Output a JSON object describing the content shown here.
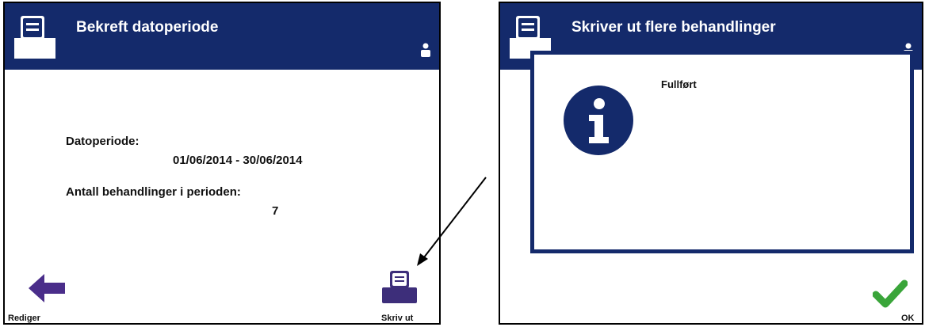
{
  "left_screen": {
    "title": "Bekreft datoperiode",
    "date_period_label": "Datoperiode:",
    "date_period_value": "01/06/2014 - 30/06/2014",
    "treatment_count_label": "Antall behandlinger i perioden:",
    "treatment_count_value": "7",
    "back_label": "Rediger",
    "print_label": "Skriv ut"
  },
  "right_screen": {
    "title": "Skriver ut flere behandlinger",
    "dialog_message": "Fullført",
    "ok_label": "OK"
  },
  "colors": {
    "header": "#142a6b",
    "back_arrow": "#4a2d8a",
    "print_icon": "#3d2e7a",
    "ok_check": "#3aa53a"
  },
  "icons": {
    "header_icon": "printer-icon",
    "user_icon": "user-icon",
    "info_icon": "info-icon",
    "back_icon": "back-arrow-icon",
    "print_icon": "printer-icon",
    "ok_icon": "checkmark-icon"
  }
}
